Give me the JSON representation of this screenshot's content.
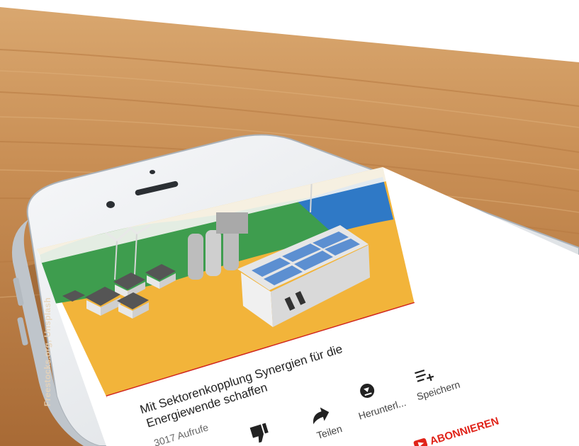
{
  "photo_credit": "Freestocks.org, Unsplash",
  "video": {
    "title_line1": "Mit Sektorenkopplung Synergien für die",
    "title_line2": "Energiewende schaffen",
    "views": "3017 Aufrufe"
  },
  "actions": {
    "share": "Teilen",
    "download": "Herunterl...",
    "save": "Speichern",
    "subscribe": "ABONNIEREN"
  },
  "colors": {
    "wood": "#c98f55",
    "phone_frame": "#e9ecef",
    "video_yellow": "#f2b43a",
    "video_green": "#3e9d4e",
    "video_blue": "#2f79c6",
    "progress_red": "#d0261f",
    "subscribe_red": "#e0241a"
  }
}
